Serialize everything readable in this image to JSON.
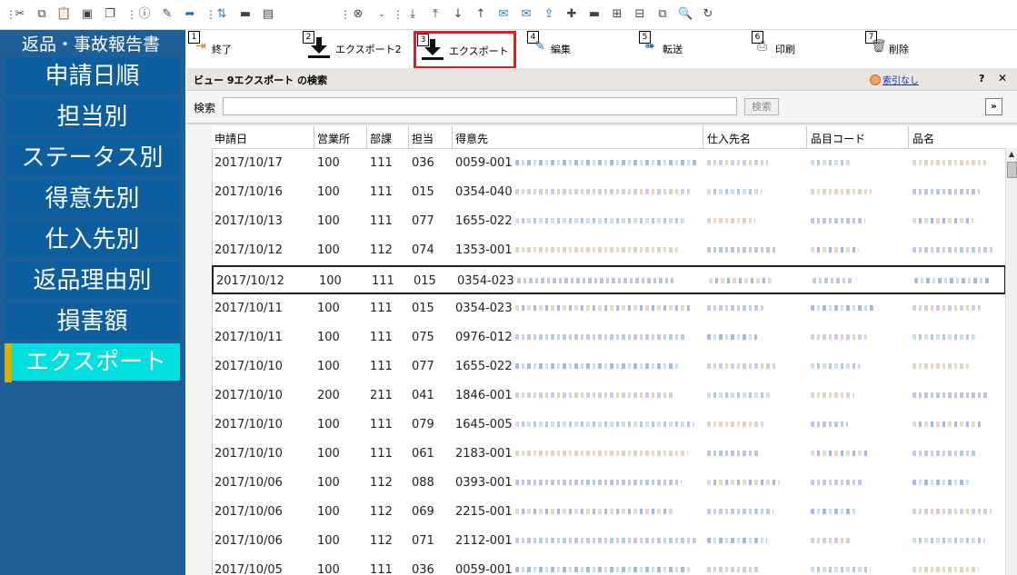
{
  "toolbar": {
    "icons": [
      "cut-icon",
      "copy-icon",
      "paste-icon",
      "paste-special-icon",
      "duplicate-icon",
      "sep",
      "info-icon",
      "edit-icon",
      "export-icon",
      "sep",
      "import-icon",
      "toolbox-icon",
      "window-icon",
      "sep",
      "clear-icon",
      "sort-icon",
      "sep",
      "move-down-icon",
      "move-top-icon",
      "arrow-down-icon",
      "arrow-up-icon",
      "mail-icon",
      "mail-forward-icon",
      "upload-icon",
      "plus-icon",
      "minus-icon",
      "add-row-icon",
      "remove-row-icon",
      "copy-window-icon",
      "search-doc-icon",
      "refresh-icon"
    ]
  },
  "sidebar": {
    "title": "返品・事故報告書",
    "items": [
      {
        "label": "申請日順",
        "marker": "#1a8a70"
      },
      {
        "label": "担当別",
        "marker": "#1a8a70"
      },
      {
        "label": "ステータス別",
        "marker": "#1a8a70"
      },
      {
        "label": "得意先別",
        "marker": "#1a8a70"
      },
      {
        "label": "仕入先別",
        "marker": "#1a8a70"
      },
      {
        "label": "返品理由別",
        "marker": "#1a8a70"
      },
      {
        "label": "損害額",
        "marker": "#c0401a"
      },
      {
        "label": "エクスポート",
        "marker": "#d8b000"
      }
    ]
  },
  "commands": [
    {
      "num": "1",
      "label": "終了"
    },
    {
      "num": "2",
      "label": "エクスポート2"
    },
    {
      "num": "3",
      "label": "エクスポート"
    },
    {
      "num": "4",
      "label": "編集"
    },
    {
      "num": "5",
      "label": "転送"
    },
    {
      "num": "6",
      "label": "印刷"
    },
    {
      "num": "7",
      "label": "削除"
    }
  ],
  "search_pane": {
    "title": "ビュー 9エクスポート の検索",
    "no_index": "索引なし",
    "help": "?",
    "close": "✕",
    "search_label": "検索",
    "search_value": "",
    "search_button": "検索",
    "expand": "»"
  },
  "table": {
    "columns": [
      "申請日",
      "営業所",
      "部課",
      "担当",
      "得意先",
      "仕入先名",
      "品目コード",
      "品名"
    ],
    "rows": [
      [
        "2017/10/17",
        "100",
        "111",
        "036",
        "0059-001"
      ],
      [
        "2017/10/16",
        "100",
        "111",
        "015",
        "0354-040"
      ],
      [
        "2017/10/13",
        "100",
        "111",
        "077",
        "1655-022"
      ],
      [
        "2017/10/12",
        "100",
        "112",
        "074",
        "1353-001"
      ],
      [
        "2017/10/12",
        "100",
        "111",
        "015",
        "0354-023"
      ],
      [
        "2017/10/11",
        "100",
        "111",
        "015",
        "0354-023"
      ],
      [
        "2017/10/11",
        "100",
        "111",
        "075",
        "0976-012"
      ],
      [
        "2017/10/10",
        "100",
        "111",
        "077",
        "1655-022"
      ],
      [
        "2017/10/10",
        "200",
        "211",
        "041",
        "1846-001"
      ],
      [
        "2017/10/10",
        "100",
        "111",
        "079",
        "1645-005"
      ],
      [
        "2017/10/10",
        "100",
        "111",
        "061",
        "2183-001"
      ],
      [
        "2017/10/06",
        "100",
        "112",
        "088",
        "0393-001"
      ],
      [
        "2017/10/06",
        "100",
        "112",
        "069",
        "2215-001"
      ],
      [
        "2017/10/06",
        "100",
        "112",
        "071",
        "2112-001"
      ],
      [
        "2017/10/05",
        "100",
        "111",
        "036",
        "0059-001"
      ]
    ],
    "selected_row": 4
  }
}
